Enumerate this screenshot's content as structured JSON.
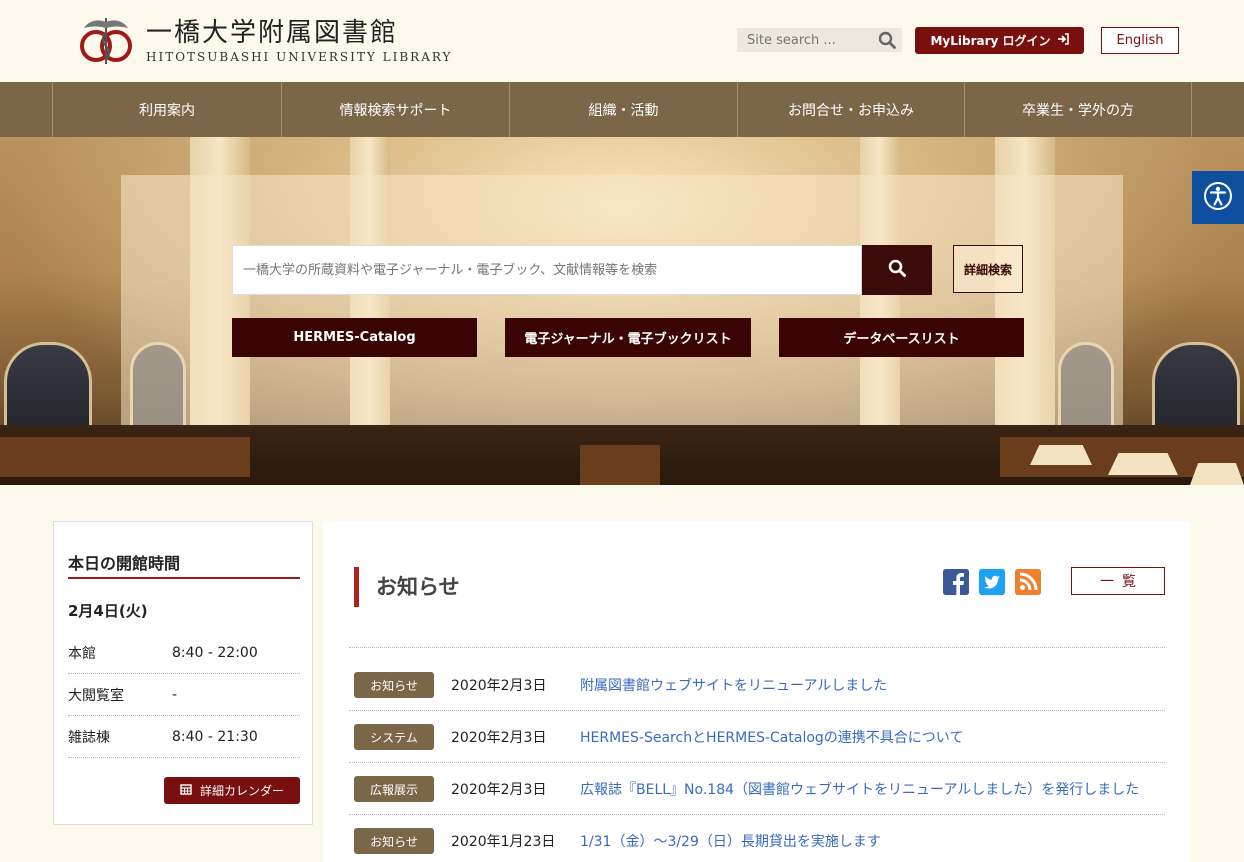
{
  "header": {
    "title_jp": "一橋大学附属図書館",
    "title_en": "HITOTSUBASHI UNIVERSITY LIBRARY",
    "site_search_placeholder": "Site search ...",
    "mylibrary_label": "MyLibrary ログイン",
    "english_label": "English"
  },
  "nav": {
    "items": [
      {
        "label": "利用案内"
      },
      {
        "label": "情報検索サポート"
      },
      {
        "label": "組織・活動"
      },
      {
        "label": "お問合せ・お申込み"
      },
      {
        "label": "卒業生・学外の方"
      }
    ]
  },
  "hero": {
    "search_placeholder": "一橋大学の所蔵資料や電子ジャーナル・電子ブック、文献情報等を検索",
    "advanced_label": "詳細検索",
    "quick_links": [
      {
        "label": "HERMES-Catalog"
      },
      {
        "label": "電子ジャーナル・電子ブックリスト"
      },
      {
        "label": "データベースリスト"
      }
    ]
  },
  "hours": {
    "title": "本日の開館時間",
    "date": "2月4日(火)",
    "rows": [
      {
        "name": "本館",
        "time": "8:40 - 22:00"
      },
      {
        "name": "大閲覧室",
        "time": "-"
      },
      {
        "name": "雑誌棟",
        "time": "8:40 - 21:30"
      }
    ],
    "calendar_label": "詳細カレンダー"
  },
  "news": {
    "title": "お知らせ",
    "all_label": "一覧",
    "items": [
      {
        "badge": "お知らせ",
        "date": "2020年2月3日",
        "text": "附属図書館ウェブサイトをリニューアルしました"
      },
      {
        "badge": "システム",
        "date": "2020年2月3日",
        "text": "HERMES-SearchとHERMES-Catalogの連携不具合について"
      },
      {
        "badge": "広報展示",
        "date": "2020年2月3日",
        "text": "広報誌『BELL』No.184（図書館ウェブサイトをリニューアルしました）を発行しました"
      },
      {
        "badge": "お知らせ",
        "date": "2020年1月23日",
        "text": "1/31（金）～3/29（日）長期貸出を実施します"
      }
    ]
  },
  "colors": {
    "nav_bg": "#7c6648",
    "accent_red": "#7a0f0f",
    "dark_button": "#3b0404",
    "link": "#3a6bbf",
    "accessibility_blue": "#0f4fa0"
  },
  "icons": [
    "logo-emblem",
    "search-icon",
    "login-icon",
    "accessibility-icon",
    "calendar-icon",
    "facebook-icon",
    "twitter-icon",
    "rss-icon"
  ]
}
